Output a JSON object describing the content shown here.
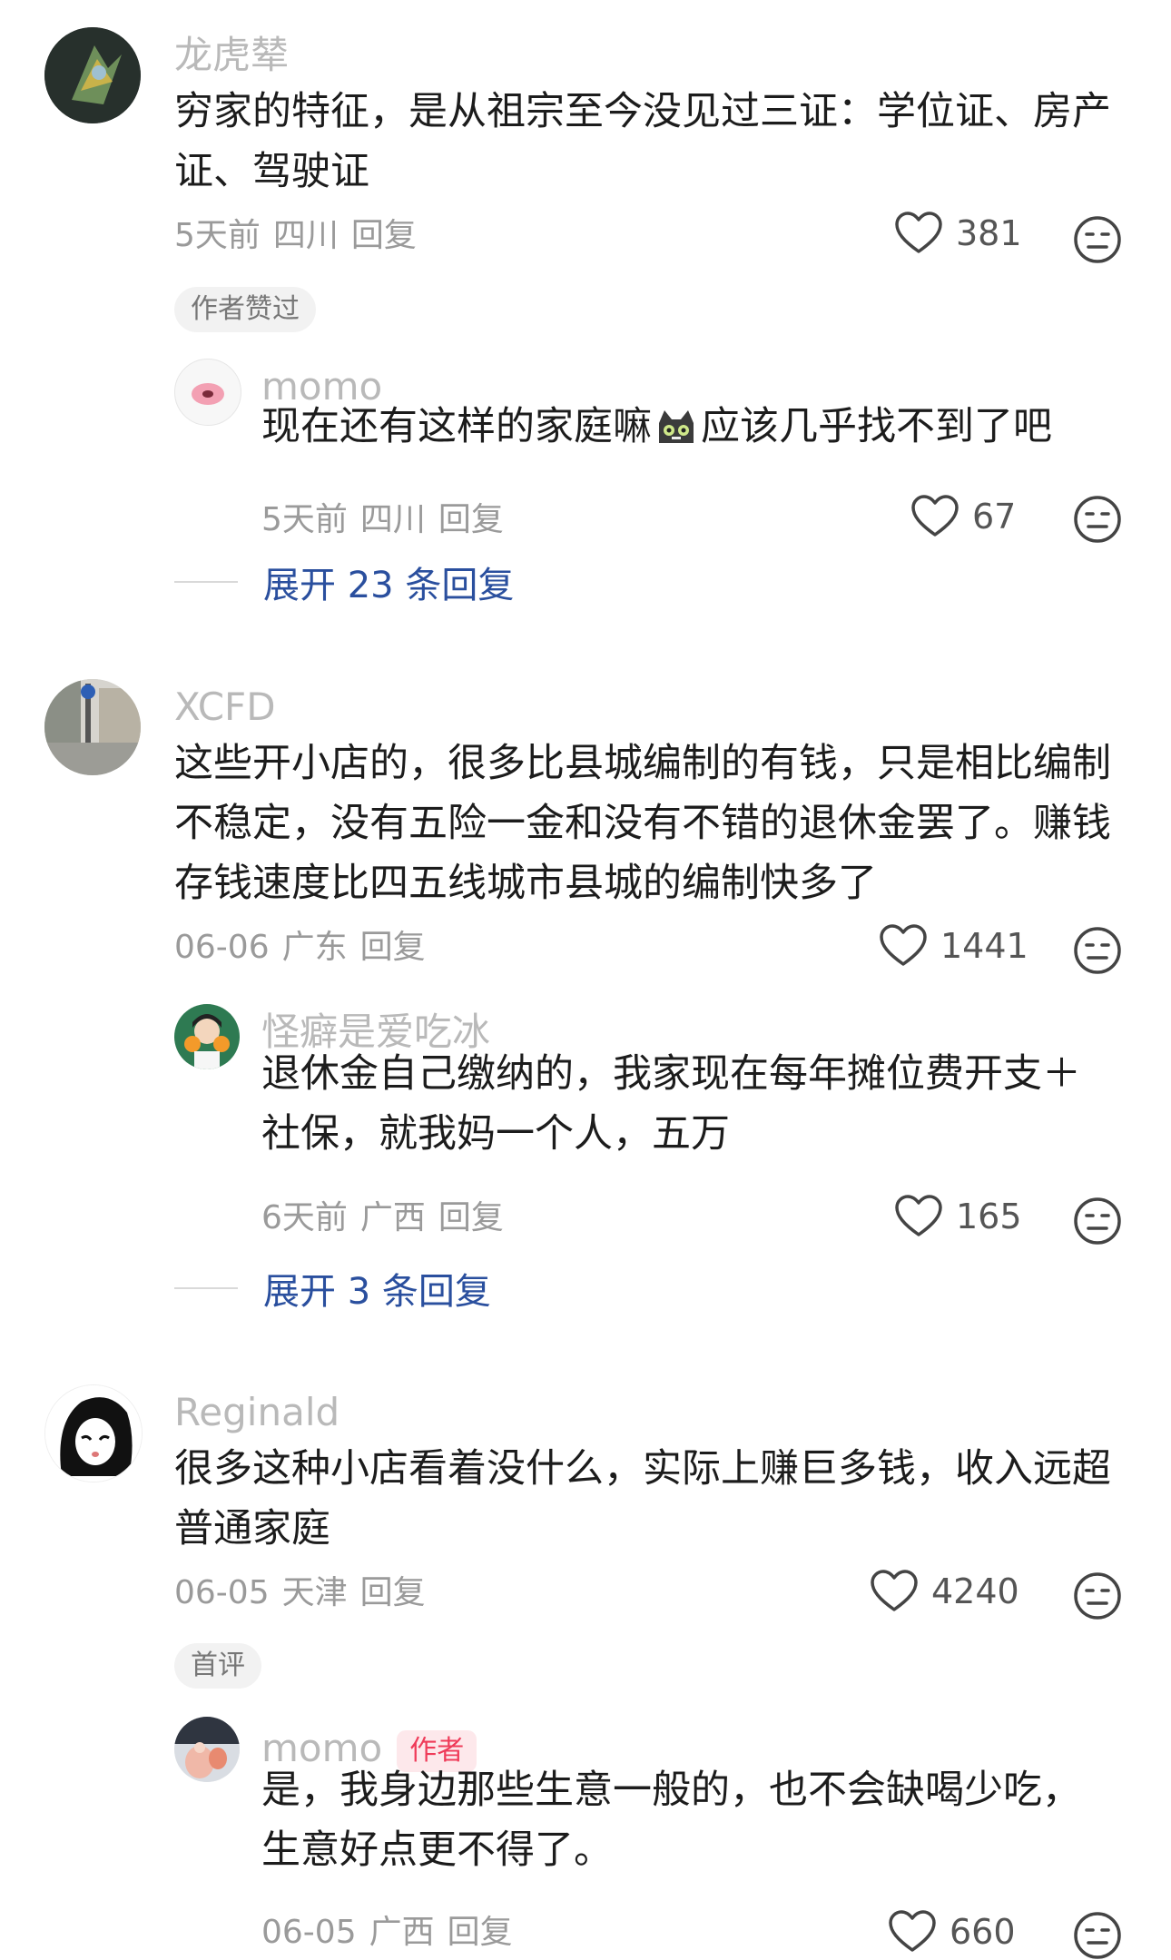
{
  "comments": [
    {
      "user": "龙虎辇",
      "text": "穷家的特征，是从祖宗至今没见过三证：学位证、房产证、驾驶证",
      "meta": {
        "time": "5天前",
        "location": "四川",
        "reply": "回复"
      },
      "likes": "381",
      "tag": "作者赞过",
      "reply": {
        "user": "momo",
        "text_before": "现在还有这样的家庭嘛",
        "text_after": "应该几乎找不到了吧",
        "meta": {
          "time": "5天前",
          "location": "四川",
          "reply": "回复"
        },
        "likes": "67"
      },
      "expand": "展开 23 条回复"
    },
    {
      "user": "XCFD",
      "text": "这些开小店的，很多比县城编制的有钱，只是相比编制不稳定，没有五险一金和没有不错的退休金罢了。赚钱存钱速度比四五线城市县城的编制快多了",
      "meta": {
        "time": "06-06",
        "location": "广东",
        "reply": "回复"
      },
      "likes": "1441",
      "reply": {
        "user": "怪癖是爱吃冰",
        "text": "退休金自己缴纳的，我家现在每年摊位费开支＋社保，就我妈一个人，五万",
        "meta": {
          "time": "6天前",
          "location": "广西",
          "reply": "回复"
        },
        "likes": "165"
      },
      "expand": "展开 3 条回复"
    },
    {
      "user": "Reginald",
      "text": "很多这种小店看着没什么，实际上赚巨多钱，收入远超普通家庭",
      "meta": {
        "time": "06-05",
        "location": "天津",
        "reply": "回复"
      },
      "likes": "4240",
      "tag": "首评",
      "reply": {
        "user": "momo",
        "badge": "作者",
        "text": "是，我身边那些生意一般的，也不会缺喝少吃，生意好点更不得了。",
        "meta": {
          "time": "06-05",
          "location": "广西",
          "reply": "回复"
        },
        "likes": "660"
      }
    }
  ],
  "colors": {
    "name": "#b9b9b9",
    "expand": "#2a4f9e",
    "author_badge_bg": "#fde8eb",
    "author_badge_fg": "#ef3b59"
  },
  "icons": [
    "heart-icon",
    "dislike-face-icon",
    "cat-emoji-icon"
  ]
}
